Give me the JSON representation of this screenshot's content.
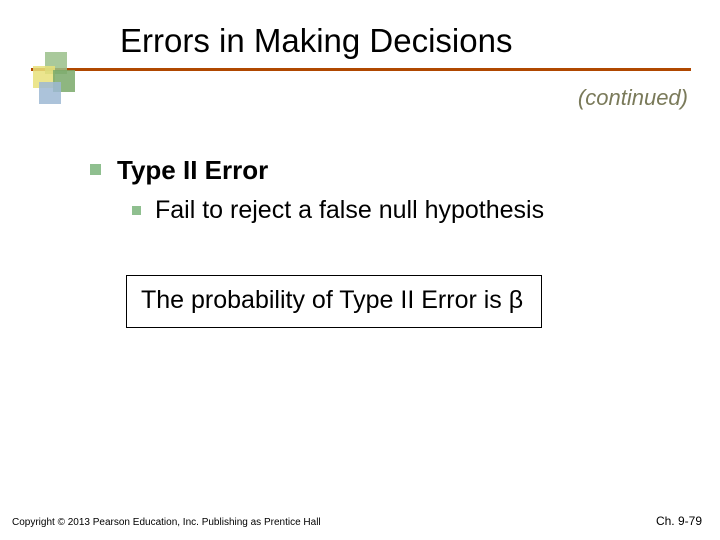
{
  "title": "Errors in Making Decisions",
  "continued": "(continued)",
  "bullets": {
    "lvl1": "Type II Error",
    "lvl2": "Fail to reject a false null hypothesis"
  },
  "box": "The probability of Type II Error is  β",
  "footer": {
    "copyright": "Copyright © 2013 Pearson Education, Inc. Publishing as Prentice Hall",
    "page": "Ch. 9-79"
  }
}
